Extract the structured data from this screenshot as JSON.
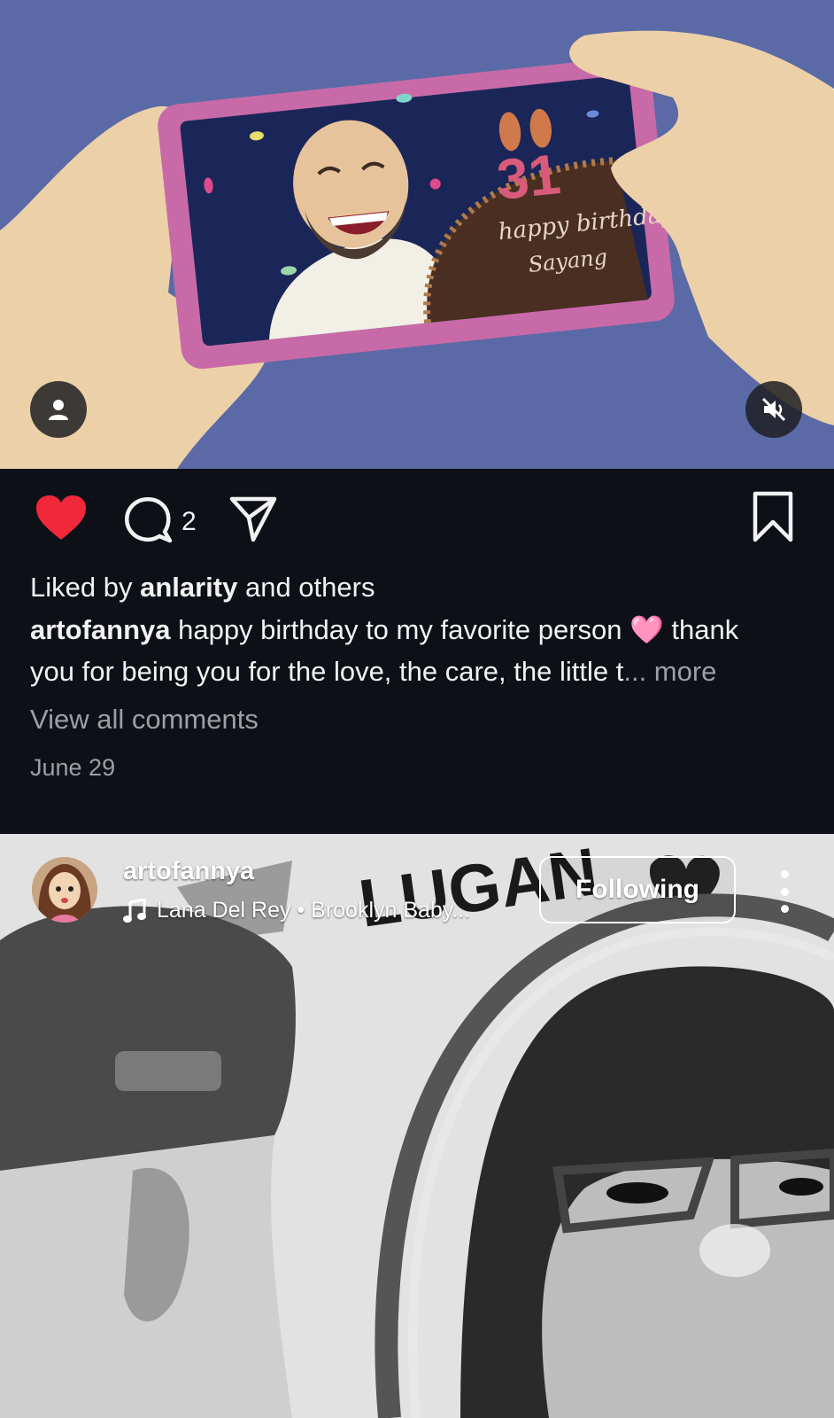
{
  "post1": {
    "artwork_text": {
      "candle_number": "31",
      "cake_line1": "happy birthday",
      "cake_line2": "Sayang"
    },
    "comment_count": "2",
    "liked_by_prefix": "Liked by ",
    "liked_by_user": "anlarity",
    "liked_by_suffix": " and others",
    "caption_user": "artofannya",
    "caption_text_1": " happy birthday to my favorite person ",
    "caption_emoji": "🩷",
    "caption_text_2": " thank",
    "caption_line2": "you for being you for the love, the care, the little t",
    "caption_ellipsis": "... more",
    "view_comments": "View all comments",
    "date": "June 29"
  },
  "post2": {
    "username": "artofannya",
    "music_artist": "Lana Del Rey",
    "music_separator": " • ",
    "music_track": "Brooklyn Baby...",
    "follow_label": "Following",
    "banner_text": "LUGAN"
  },
  "colors": {
    "like": "#f0283a",
    "background": "#0d1016",
    "muted_text": "#9aa0a8",
    "media_bg": "#5b6aa6"
  },
  "icons": [
    "user-icon",
    "mute-icon",
    "heart-icon",
    "comment-icon",
    "share-icon",
    "bookmark-icon",
    "music-note-icon",
    "more-icon"
  ]
}
